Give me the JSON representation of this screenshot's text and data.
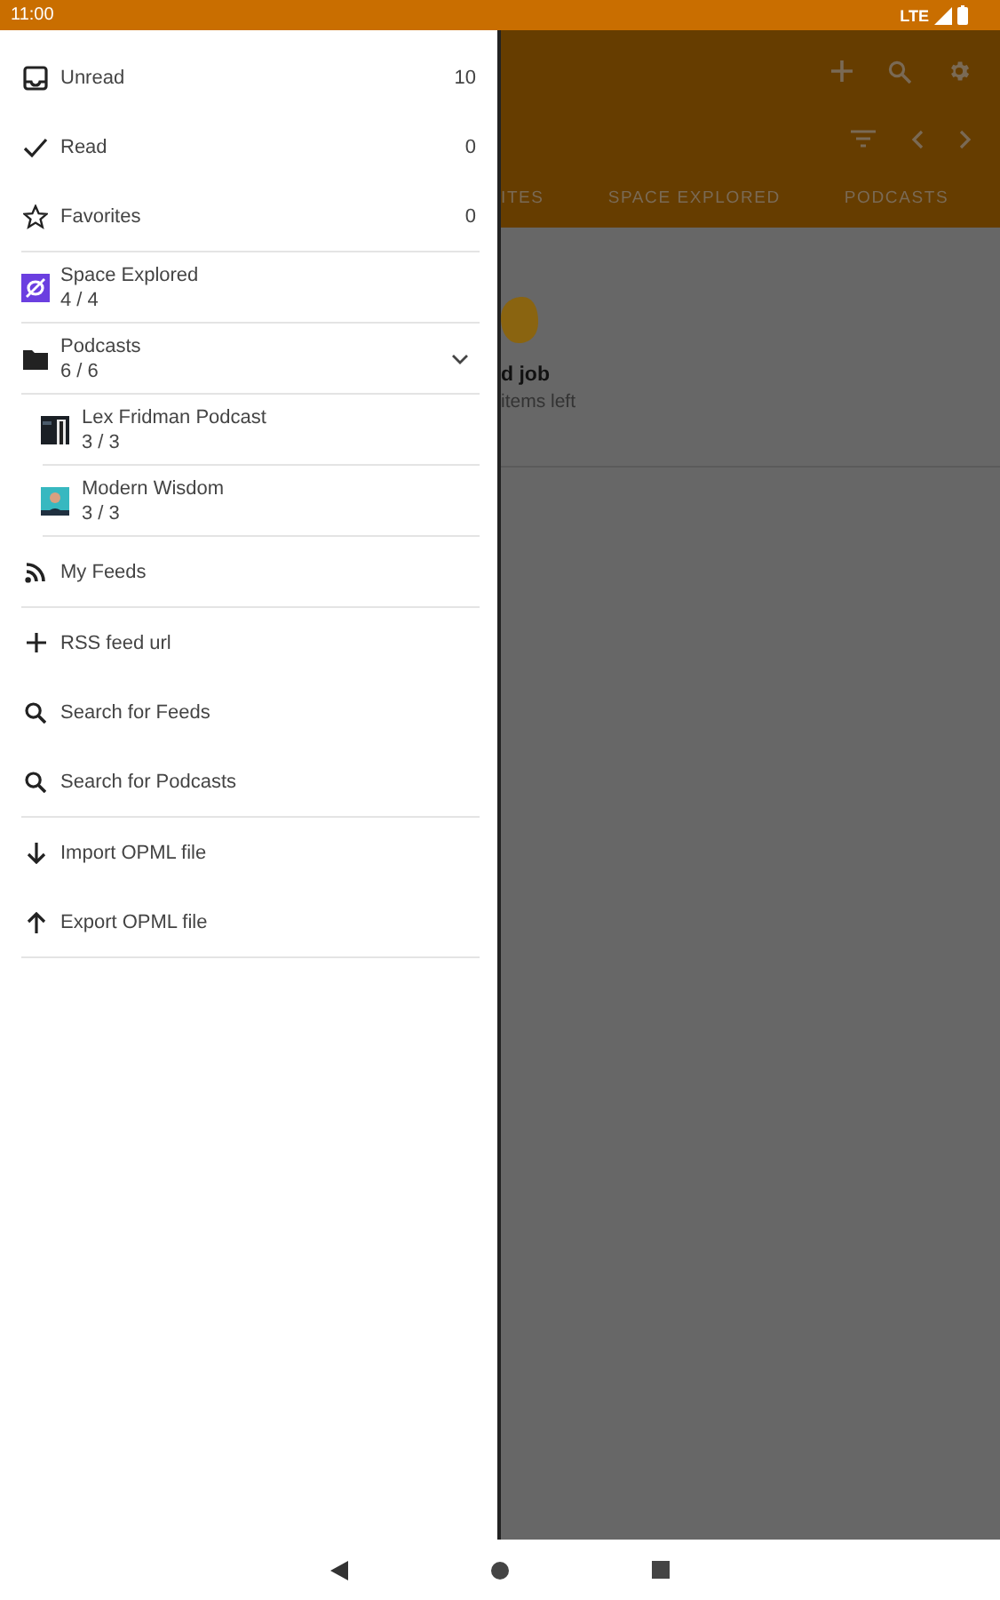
{
  "status_bar": {
    "time": "11:00",
    "network": "LTE"
  },
  "drawer": {
    "groups": [
      [
        {
          "kind": "count",
          "label": "Unread",
          "count": "10"
        },
        {
          "kind": "count",
          "label": "Read",
          "count": "0"
        },
        {
          "kind": "count",
          "label": "Favorites",
          "count": "0"
        }
      ],
      [
        {
          "kind": "feed",
          "label": "Space Explored",
          "count": "4 / 4"
        }
      ],
      [
        {
          "kind": "folder",
          "label": "Podcasts",
          "count": "6 / 6",
          "expanded": true,
          "children": [
            {
              "kind": "feed",
              "label": "Lex Fridman Podcast",
              "count": "3 / 3"
            },
            {
              "kind": "feed",
              "label": "Modern Wisdom",
              "count": "3 / 3"
            }
          ]
        }
      ],
      [
        {
          "kind": "action",
          "label": "My Feeds"
        }
      ],
      [
        {
          "kind": "action",
          "label": "RSS feed url"
        },
        {
          "kind": "action",
          "label": "Search for Feeds"
        },
        {
          "kind": "action",
          "label": "Search for Podcasts"
        }
      ],
      [
        {
          "kind": "action",
          "label": "Import OPML file"
        },
        {
          "kind": "action",
          "label": "Export OPML file"
        }
      ]
    ]
  },
  "background": {
    "tabs": [
      {
        "label": "ITES"
      },
      {
        "label": "SPACE EXPLORED"
      },
      {
        "label": "PODCASTS"
      }
    ],
    "empty_title": "d job",
    "empty_text": "items left"
  }
}
